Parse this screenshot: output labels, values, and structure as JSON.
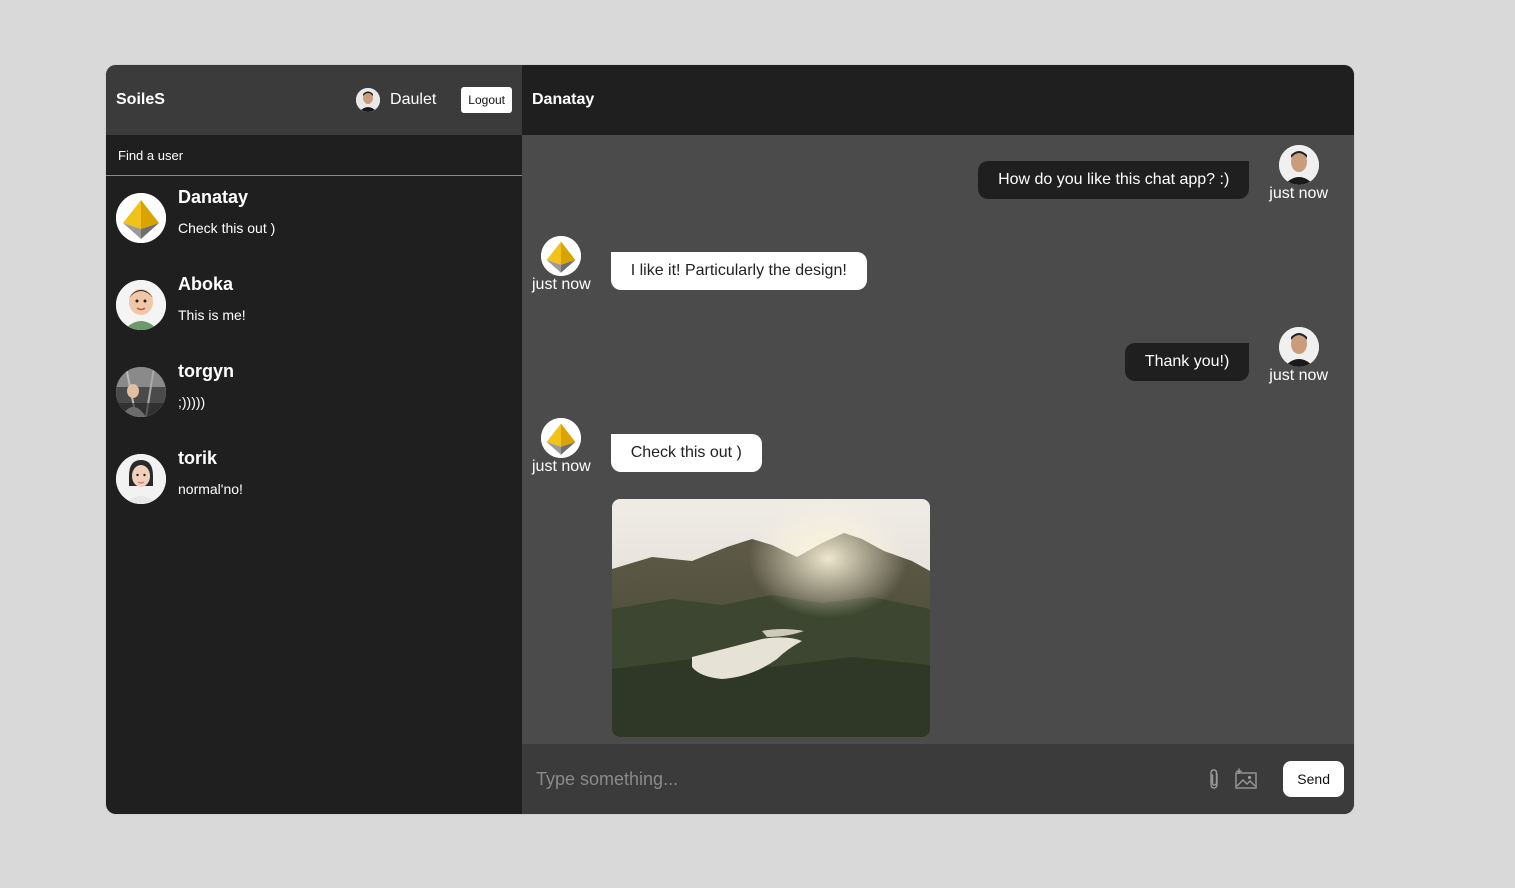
{
  "sidebar": {
    "logo": "SoileS",
    "current_user": {
      "name": "Daulet"
    },
    "logout_label": "Logout",
    "search_placeholder": "Find a user",
    "chats": [
      {
        "name": "Danatay",
        "last_message": "Check this out )",
        "avatar": "pyramid-logo"
      },
      {
        "name": "Aboka",
        "last_message": "This is me!",
        "avatar": "baby-photo"
      },
      {
        "name": "torgyn",
        "last_message": ";)))))",
        "avatar": "person-photo"
      },
      {
        "name": "torik",
        "last_message": "normal'no!",
        "avatar": "woman-photo"
      }
    ]
  },
  "chat": {
    "title": "Danatay",
    "messages": [
      {
        "owner": true,
        "text": "How do you like this chat app? :)",
        "time": "just now"
      },
      {
        "owner": false,
        "text": "I like it! Particularly the design!",
        "time": "just now"
      },
      {
        "owner": true,
        "text": "Thank you!)",
        "time": "just now"
      },
      {
        "owner": false,
        "text": "Check this out )",
        "time": "just now",
        "image": "mountain-lake-photo"
      }
    ],
    "input_placeholder": "Type something...",
    "send_label": "Send"
  },
  "colors": {
    "sidebar_bg": "#1f1f1f",
    "navbar_bg": "#3b3b3b",
    "chat_bg": "#4b4b4b",
    "page_bg": "#d9d9d9"
  }
}
